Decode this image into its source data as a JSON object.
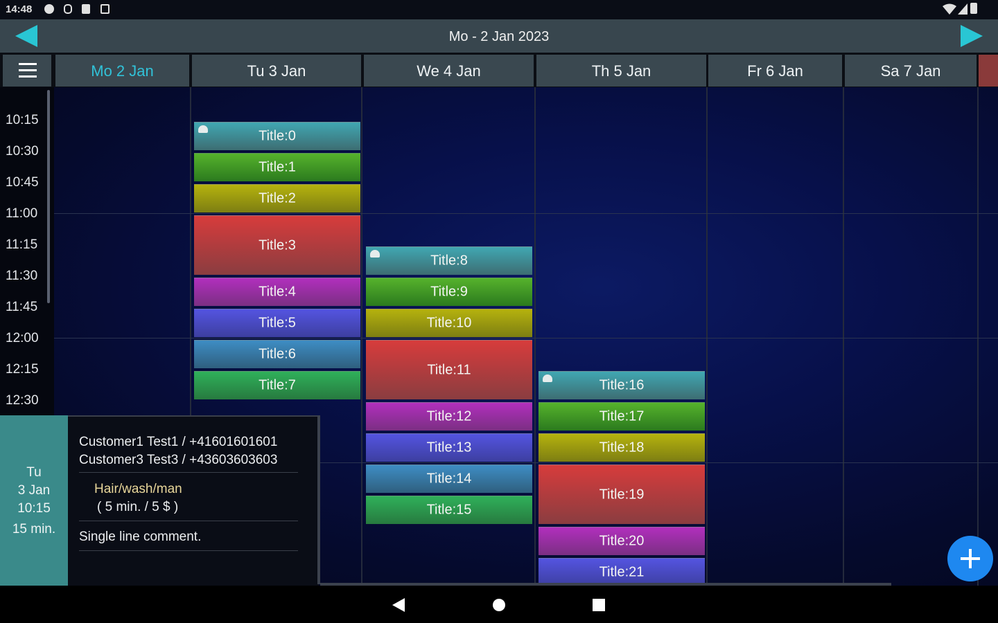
{
  "status_bar": {
    "time": "14:48"
  },
  "header": {
    "date_title": "Mo - 2 Jan 2023"
  },
  "days": [
    {
      "label": "Mo   2 Jan",
      "today": true
    },
    {
      "label": "Tu   3 Jan"
    },
    {
      "label": "We   4 Jan"
    },
    {
      "label": "Th   5 Jan"
    },
    {
      "label": "Fr   6 Jan"
    },
    {
      "label": "Sa   7 Jan"
    }
  ],
  "times": [
    "10:15",
    "10:30",
    "10:45",
    "11:00",
    "11:15",
    "11:30",
    "11:45",
    "12:00",
    "12:15",
    "12:30"
  ],
  "events": {
    "tue": [
      "Title:0",
      "Title:1",
      "Title:2",
      "Title:3",
      "Title:4",
      "Title:5",
      "Title:6",
      "Title:7"
    ],
    "wed": [
      "Title:8",
      "Title:9",
      "Title:10",
      "Title:11",
      "Title:12",
      "Title:13",
      "Title:14",
      "Title:15"
    ],
    "thu": [
      "Title:16",
      "Title:17",
      "Title:18",
      "Title:19",
      "Title:20",
      "Title:21"
    ]
  },
  "detail": {
    "day": "Tu",
    "date": "3 Jan",
    "time": "10:15",
    "duration": "15 min.",
    "customer_1": "Customer1 Test1 / +41601601601",
    "customer_2": "Customer3 Test3 / +43603603603",
    "service": "Hair/wash/man",
    "service_meta": "(  5 min. / 5 $ )",
    "comment": "Single line comment."
  },
  "colors": {
    "accent": "#31c2d8",
    "fab": "#1e88f0",
    "header": "#38464e"
  }
}
